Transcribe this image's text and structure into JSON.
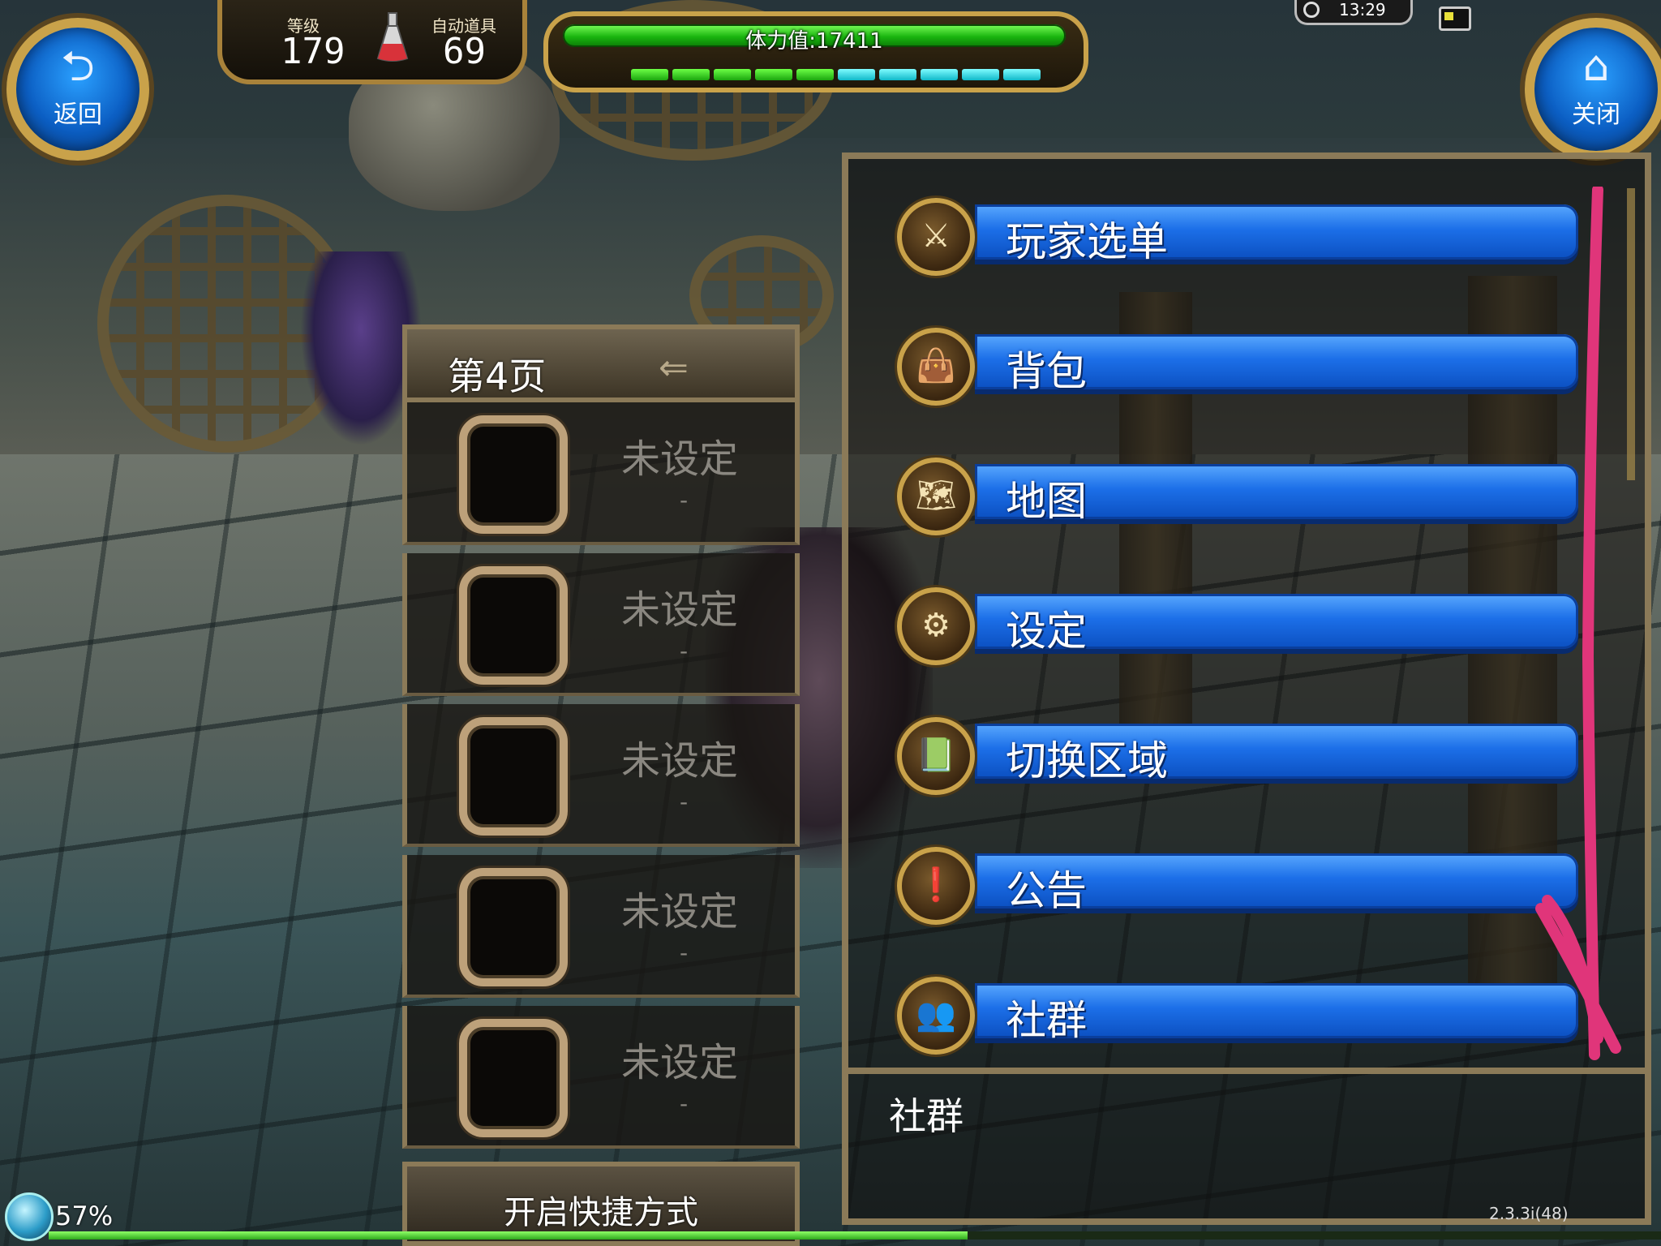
{
  "hud": {
    "back_label": "返回",
    "close_label": "关闭",
    "level_caption": "等级",
    "level_value": "179",
    "auto_item_caption": "自动道具",
    "auto_item_value": "69",
    "hp_text": "体力值:17411",
    "hp_fill": 1.0,
    "segment_colors": [
      "green",
      "green",
      "green",
      "green",
      "green",
      "cyan",
      "cyan",
      "cyan",
      "cyan",
      "cyan"
    ],
    "clock": "13:29",
    "battery_level": 0.5
  },
  "quick_panel": {
    "title": "第4页",
    "arrow_glyph": "⇐",
    "slots": [
      {
        "label": "未设定",
        "sub": "-"
      },
      {
        "label": "未设定",
        "sub": "-"
      },
      {
        "label": "未设定",
        "sub": "-"
      },
      {
        "label": "未设定",
        "sub": "-"
      },
      {
        "label": "未设定",
        "sub": "-"
      }
    ],
    "footer_label": "开启快捷方式"
  },
  "menu": {
    "items": [
      {
        "label": "玩家选单",
        "icon": "sword-shield-icon",
        "glyph": "⚔"
      },
      {
        "label": "背包",
        "icon": "bag-icon",
        "glyph": "👜"
      },
      {
        "label": "地图",
        "icon": "map-icon",
        "glyph": "🗺"
      },
      {
        "label": "设定",
        "icon": "gears-icon",
        "glyph": "⚙"
      },
      {
        "label": "切换区域",
        "icon": "book-icon",
        "glyph": "📗"
      },
      {
        "label": "公告",
        "icon": "notice-icon",
        "glyph": "❗"
      },
      {
        "label": "社群",
        "icon": "community-icon",
        "glyph": "👥"
      }
    ],
    "selected_label": "社群",
    "version": "2.3.3i(48)"
  },
  "bottom": {
    "percent": "57%",
    "xp_fill": 0.57
  },
  "colors": {
    "menu_blue": "#1c6fe8",
    "gold_trim": "#c9a24a",
    "annotation_pink": "#e0357a",
    "hp_green": "#19b50f"
  }
}
